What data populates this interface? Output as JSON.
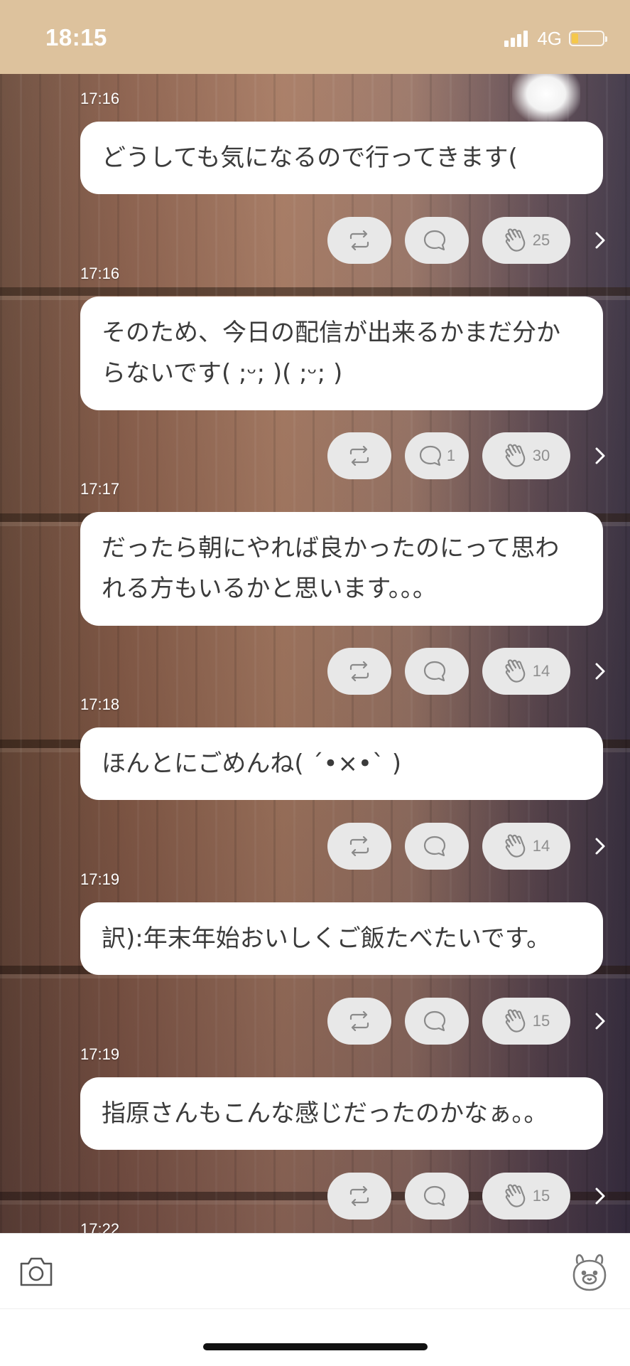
{
  "status": {
    "time": "18:15",
    "network": "4G",
    "battery_level": 0.2,
    "signal_bars": 4
  },
  "colors": {
    "status_bar": "#ddc29d",
    "bubble": "#ffffff",
    "pill": "#e8e8e8",
    "battery_fill": "#f5c84b"
  },
  "icons": {
    "repost": "repost-icon",
    "comment": "comment-icon",
    "clap": "clap-icon",
    "more": "chevron-right-icon",
    "camera": "camera-icon",
    "mascot": "bear-mascot-icon"
  },
  "posts": [
    {
      "time": "17:16",
      "lines": [
        "どうしても気になるので行ってきます("
      ],
      "comments": "",
      "claps": "25"
    },
    {
      "time": "17:16",
      "lines": [
        "そのため、今日の配信が出来るかまだ分か",
        "らないです(  ;ᵕ;  )(  ;ᵕ;  )"
      ],
      "comments": "1",
      "claps": "30"
    },
    {
      "time": "17:17",
      "lines": [
        "だったら朝にやれば良かったのにって思わ",
        "れる方もいるかと思います。。。"
      ],
      "comments": "",
      "claps": "14"
    },
    {
      "time": "17:18",
      "lines": [
        "ほんとにごめんね( ´•×•` )"
      ],
      "comments": "",
      "claps": "14"
    },
    {
      "time": "17:19",
      "lines": [
        "訳):年末年始おいしくご飯たべたいです。"
      ],
      "comments": "",
      "claps": "15"
    },
    {
      "time": "17:19",
      "lines": [
        "指原さんもこんな感じだったのかなぁ。。"
      ],
      "comments": "",
      "claps": "15"
    }
  ],
  "partial_next_time": "17:22"
}
